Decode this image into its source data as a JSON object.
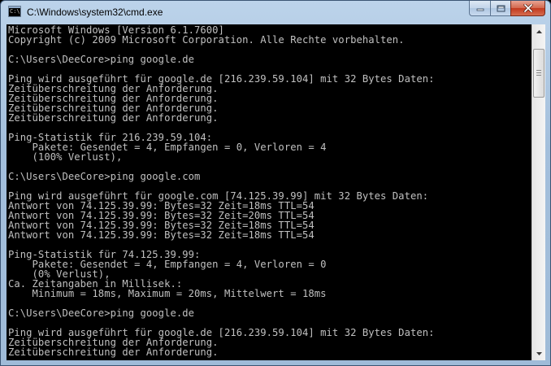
{
  "window": {
    "title": "C:\\Windows\\system32\\cmd.exe",
    "icon": "cmd-icon",
    "icon_text": "C:\\"
  },
  "caption_buttons": {
    "minimize_icon": "minimize-icon",
    "maximize_icon": "maximize-icon",
    "close_icon": "close-icon"
  },
  "console": {
    "text_color": "#c0c0c0",
    "background": "#000000",
    "lines": [
      "Microsoft Windows [Version 6.1.7600]",
      "Copyright (c) 2009 Microsoft Corporation. Alle Rechte vorbehalten.",
      "",
      "C:\\Users\\DeeCore>ping google.de",
      "",
      "Ping wird ausgeführt für google.de [216.239.59.104] mit 32 Bytes Daten:",
      "Zeitüberschreitung der Anforderung.",
      "Zeitüberschreitung der Anforderung.",
      "Zeitüberschreitung der Anforderung.",
      "Zeitüberschreitung der Anforderung.",
      "",
      "Ping-Statistik für 216.239.59.104:",
      "    Pakete: Gesendet = 4, Empfangen = 0, Verloren = 4",
      "    (100% Verlust),",
      "",
      "C:\\Users\\DeeCore>ping google.com",
      "",
      "Ping wird ausgeführt für google.com [74.125.39.99] mit 32 Bytes Daten:",
      "Antwort von 74.125.39.99: Bytes=32 Zeit=18ms TTL=54",
      "Antwort von 74.125.39.99: Bytes=32 Zeit=20ms TTL=54",
      "Antwort von 74.125.39.99: Bytes=32 Zeit=18ms TTL=54",
      "Antwort von 74.125.39.99: Bytes=32 Zeit=18ms TTL=54",
      "",
      "Ping-Statistik für 74.125.39.99:",
      "    Pakete: Gesendet = 4, Empfangen = 4, Verloren = 0",
      "    (0% Verlust),",
      "Ca. Zeitangaben in Millisek.:",
      "    Minimum = 18ms, Maximum = 20ms, Mittelwert = 18ms",
      "",
      "C:\\Users\\DeeCore>ping google.de",
      "",
      "Ping wird ausgeführt für google.de [216.239.59.104] mit 32 Bytes Daten:",
      "Zeitüberschreitung der Anforderung.",
      "Zeitüberschreitung der Anforderung."
    ]
  },
  "scrollbar": {
    "up_icon": "scroll-up-arrow-icon",
    "down_icon": "scroll-down-arrow-icon"
  }
}
